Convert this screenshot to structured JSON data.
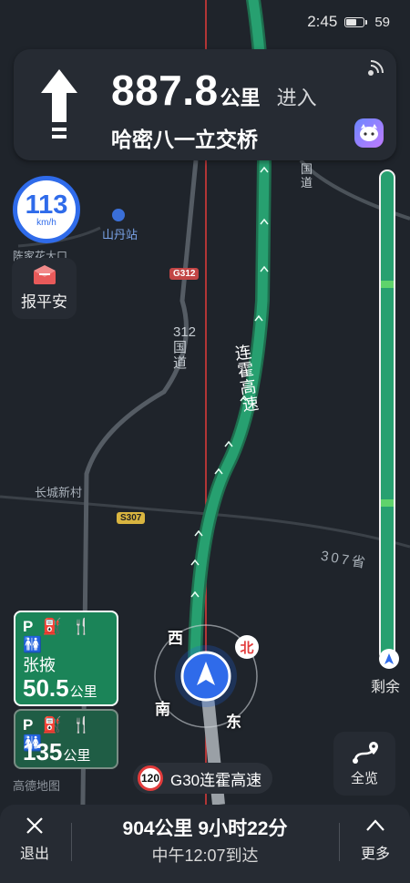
{
  "status": {
    "time": "2:45",
    "battery": "59"
  },
  "guidance": {
    "distance": "887.8",
    "unit": "公里",
    "action": "进入",
    "road": "哈密八一立交桥"
  },
  "speed": {
    "value": "113",
    "unit": "km/h"
  },
  "report": {
    "label": "报平安"
  },
  "map": {
    "station": "山丹站",
    "poi_partial": "陈家花大口",
    "village": "长城新村",
    "shield_g312": "G312",
    "shield_s307": "S307",
    "road_312_vertical": "312国道",
    "road_312_partial": "国道",
    "road_307": "307省",
    "expressway_label": "连霍高速",
    "credit": "高德地图"
  },
  "compass": {
    "west": "西",
    "east": "东",
    "south": "南",
    "north": "北"
  },
  "services": [
    {
      "icons": "P ⛽ 🍴 🚻",
      "name": "张掖",
      "distance": "50.5",
      "unit": "公里"
    },
    {
      "icons": "P ⛽ 🍴 🚻",
      "name": "",
      "distance": "135",
      "unit": "公里"
    }
  ],
  "progress": {
    "label": "剩余",
    "fraction_remaining": 1.0
  },
  "overview": {
    "label": "全览"
  },
  "road_chip": {
    "limit": "120",
    "name": "G30连霍高速"
  },
  "bottom": {
    "exit_label": "退出",
    "more_label": "更多",
    "summary": "904公里 9小时22分",
    "arrival": "中午12:07到达"
  },
  "colors": {
    "route": "#27a070",
    "map_bg": "#1f242b",
    "panel": "#262b33",
    "accent": "#2f6bea",
    "north_line": "#e23b3b"
  }
}
